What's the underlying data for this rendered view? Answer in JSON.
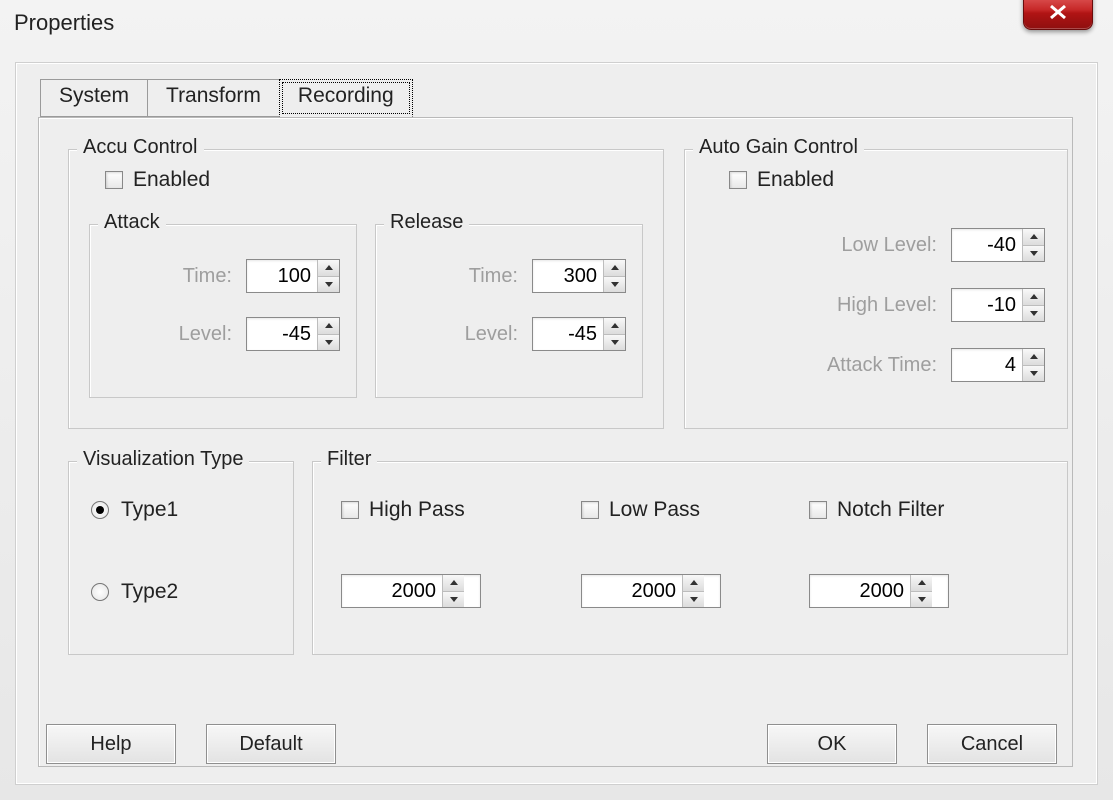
{
  "window": {
    "title": "Properties"
  },
  "tabs": {
    "system": "System",
    "transform": "Transform",
    "recording": "Recording",
    "active": "Recording"
  },
  "accu": {
    "title": "Accu Control",
    "enabled_label": "Enabled",
    "enabled": false,
    "attack": {
      "title": "Attack",
      "time_label": "Time:",
      "time": "100",
      "level_label": "Level:",
      "level": "-45"
    },
    "release": {
      "title": "Release",
      "time_label": "Time:",
      "time": "300",
      "level_label": "Level:",
      "level": "-45"
    }
  },
  "agc": {
    "title": "Auto Gain Control",
    "enabled_label": "Enabled",
    "enabled": false,
    "low_label": "Low Level:",
    "low": "-40",
    "high_label": "High Level:",
    "high": "-10",
    "attack_label": "Attack Time:",
    "attack": "4"
  },
  "vis": {
    "title": "Visualization Type",
    "type1_label": "Type1",
    "type2_label": "Type2",
    "selected": "type1"
  },
  "filter": {
    "title": "Filter",
    "highpass_label": "High Pass",
    "highpass_checked": false,
    "highpass_value": "2000",
    "lowpass_label": "Low Pass",
    "lowpass_checked": false,
    "lowpass_value": "2000",
    "notch_label": "Notch Filter",
    "notch_checked": false,
    "notch_value": "2000"
  },
  "buttons": {
    "help": "Help",
    "default": "Default",
    "ok": "OK",
    "cancel": "Cancel"
  }
}
